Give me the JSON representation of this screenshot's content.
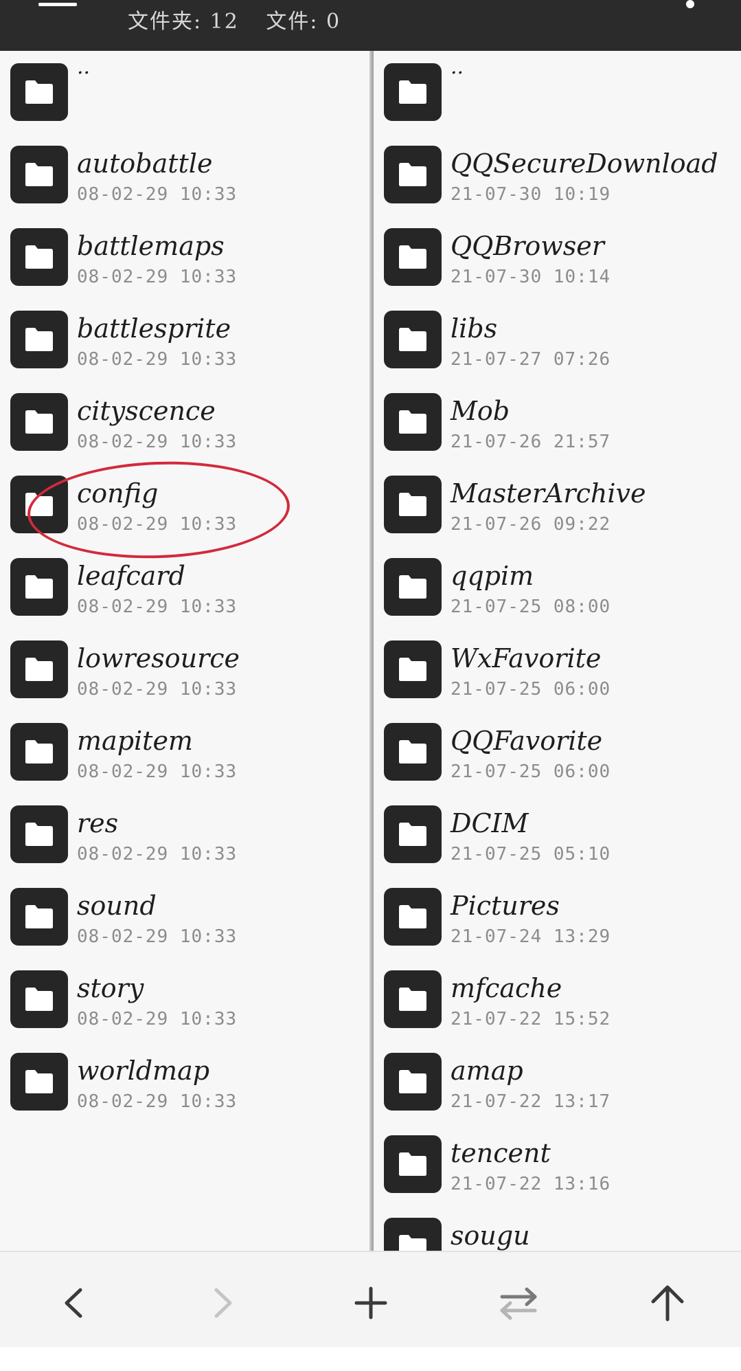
{
  "header": {
    "folders_label": "文件夹: 12",
    "files_label": "文件: 0"
  },
  "left_pane": {
    "items": [
      {
        "name": "..",
        "date": ""
      },
      {
        "name": "autobattle",
        "date": "08-02-29 10:33"
      },
      {
        "name": "battlemaps",
        "date": "08-02-29 10:33"
      },
      {
        "name": "battlesprite",
        "date": "08-02-29 10:33"
      },
      {
        "name": "cityscence",
        "date": "08-02-29 10:33"
      },
      {
        "name": "config",
        "date": "08-02-29 10:33"
      },
      {
        "name": "leafcard",
        "date": "08-02-29 10:33"
      },
      {
        "name": "lowresource",
        "date": "08-02-29 10:33"
      },
      {
        "name": "mapitem",
        "date": "08-02-29 10:33"
      },
      {
        "name": "res",
        "date": "08-02-29 10:33"
      },
      {
        "name": "sound",
        "date": "08-02-29 10:33"
      },
      {
        "name": "story",
        "date": "08-02-29 10:33"
      },
      {
        "name": "worldmap",
        "date": "08-02-29 10:33"
      }
    ]
  },
  "right_pane": {
    "items": [
      {
        "name": "..",
        "date": ""
      },
      {
        "name": "QQSecureDownload",
        "date": "21-07-30 10:19"
      },
      {
        "name": "QQBrowser",
        "date": "21-07-30 10:14"
      },
      {
        "name": "libs",
        "date": "21-07-27 07:26"
      },
      {
        "name": "Mob",
        "date": "21-07-26 21:57"
      },
      {
        "name": "MasterArchive",
        "date": "21-07-26 09:22"
      },
      {
        "name": "qqpim",
        "date": "21-07-25 08:00"
      },
      {
        "name": "WxFavorite",
        "date": "21-07-25 06:00"
      },
      {
        "name": "QQFavorite",
        "date": "21-07-25 06:00"
      },
      {
        "name": "DCIM",
        "date": "21-07-25 05:10"
      },
      {
        "name": "Pictures",
        "date": "21-07-24 13:29"
      },
      {
        "name": "mfcache",
        "date": "21-07-22 15:52"
      },
      {
        "name": "amap",
        "date": "21-07-22 13:17"
      },
      {
        "name": "tencent",
        "date": "21-07-22 13:16"
      },
      {
        "name": "sougu",
        "date": ""
      }
    ]
  },
  "toolbar": {
    "buttons": [
      {
        "icon": "back-icon"
      },
      {
        "icon": "forward-icon"
      },
      {
        "icon": "add-icon"
      },
      {
        "icon": "swap-icon"
      },
      {
        "icon": "up-icon"
      }
    ]
  },
  "colors": {
    "topbar": "#2b2b2b",
    "folder_icon_bg": "#262626",
    "highlight": "#d22a3c"
  }
}
